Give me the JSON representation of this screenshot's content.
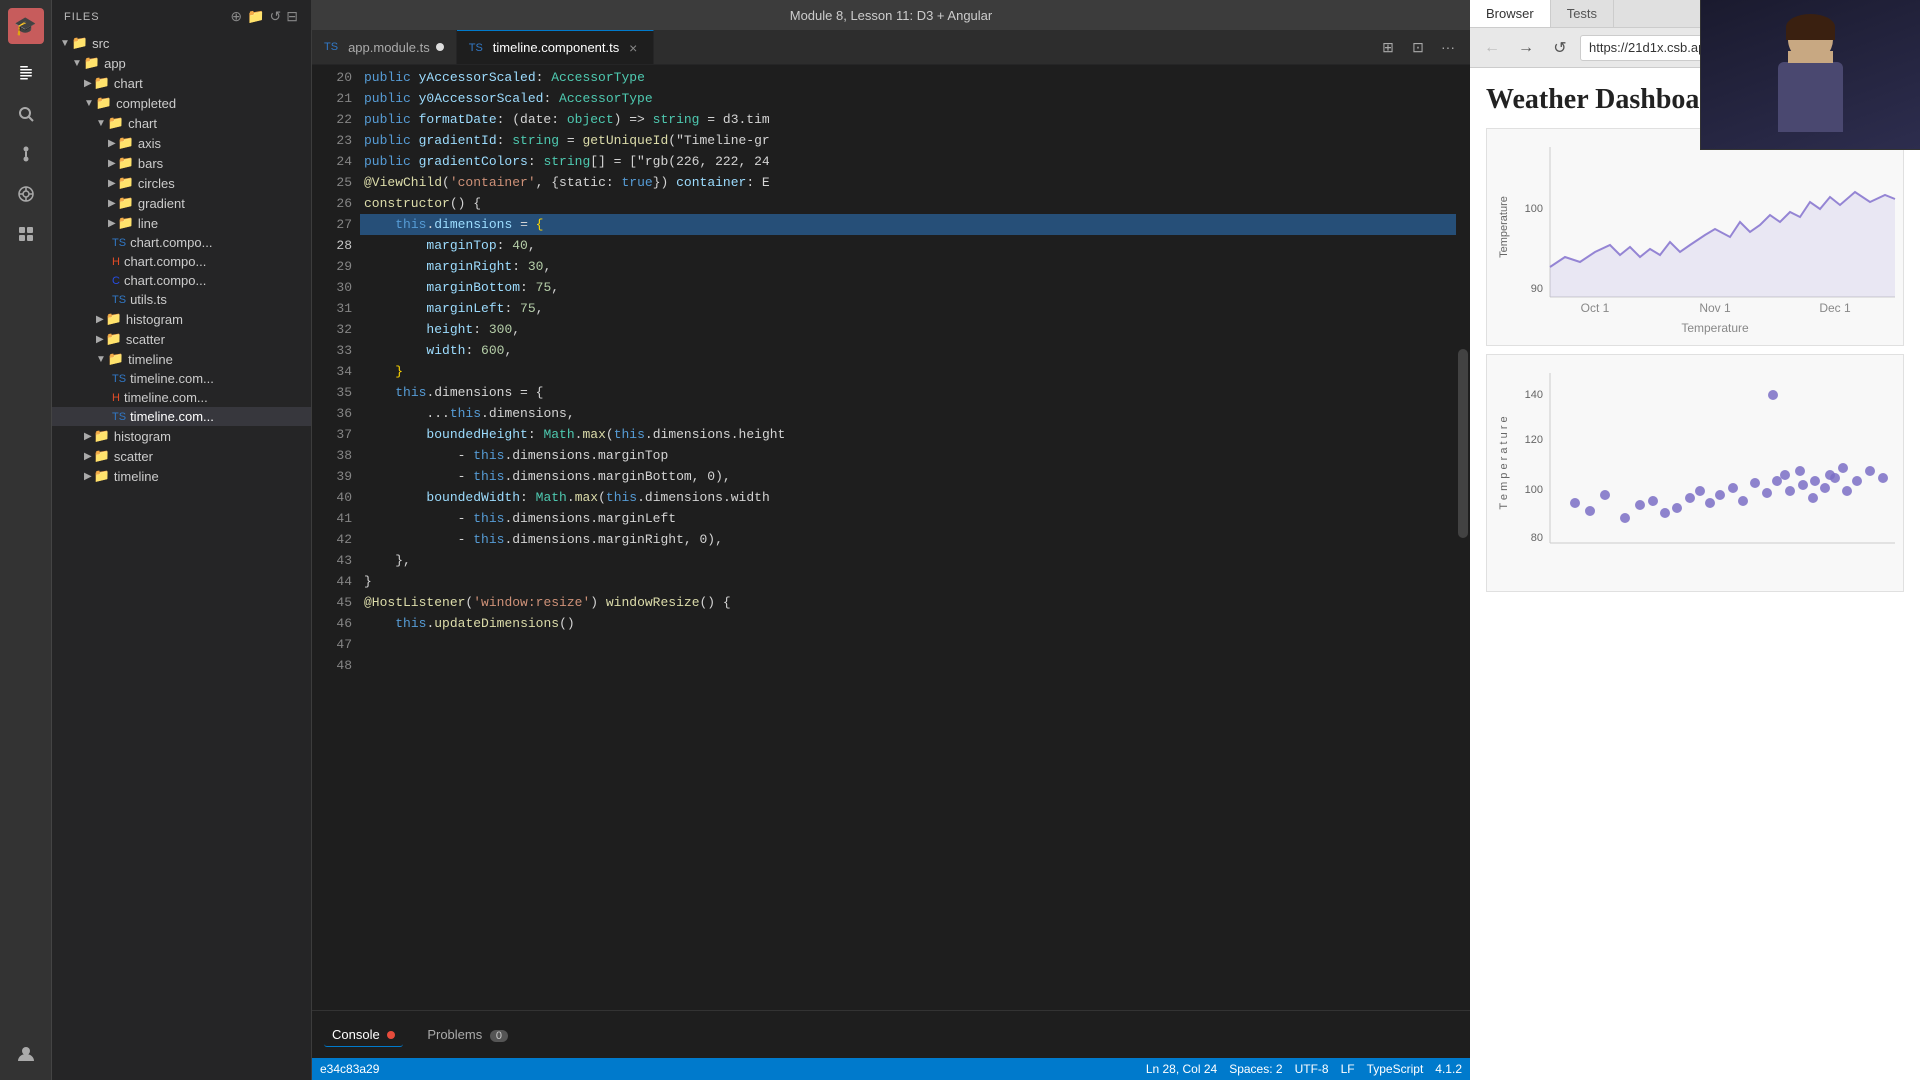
{
  "titleBar": {
    "title": "Module 8, Lesson 11: D3 + Angular"
  },
  "sidebar": {
    "logo": "🎓",
    "icons": [
      "files",
      "search",
      "git",
      "debug",
      "extensions",
      "user"
    ]
  },
  "fileExplorer": {
    "header": "Files",
    "tree": [
      {
        "id": "src",
        "type": "folder",
        "label": "src",
        "level": 0,
        "expanded": true
      },
      {
        "id": "app",
        "type": "folder",
        "label": "app",
        "level": 1,
        "expanded": true
      },
      {
        "id": "chart-folder",
        "type": "folder",
        "label": "chart",
        "level": 2,
        "expanded": false
      },
      {
        "id": "completed-folder",
        "type": "folder",
        "label": "completed",
        "level": 2,
        "expanded": true
      },
      {
        "id": "chart-sub",
        "type": "folder",
        "label": "chart",
        "level": 3,
        "expanded": true
      },
      {
        "id": "axis",
        "type": "folder",
        "label": "axis",
        "level": 4,
        "expanded": false
      },
      {
        "id": "bars",
        "type": "folder",
        "label": "bars",
        "level": 4,
        "expanded": false
      },
      {
        "id": "circles",
        "type": "folder",
        "label": "circles",
        "level": 4,
        "expanded": false
      },
      {
        "id": "gradient",
        "type": "folder",
        "label": "gradient",
        "level": 4,
        "expanded": false
      },
      {
        "id": "line",
        "type": "folder",
        "label": "line",
        "level": 4,
        "expanded": false
      },
      {
        "id": "chart-comp1",
        "type": "ts",
        "label": "chart.compo...",
        "level": 4
      },
      {
        "id": "chart-comp2",
        "type": "html",
        "label": "chart.compo...",
        "level": 4
      },
      {
        "id": "chart-comp3",
        "type": "css",
        "label": "chart.compo...",
        "level": 4
      },
      {
        "id": "utils",
        "type": "ts",
        "label": "utils.ts",
        "level": 4
      },
      {
        "id": "histogram-folder",
        "type": "folder",
        "label": "histogram",
        "level": 3,
        "expanded": false
      },
      {
        "id": "scatter-folder",
        "type": "folder",
        "label": "scatter",
        "level": 3,
        "expanded": false
      },
      {
        "id": "timeline-folder",
        "type": "folder",
        "label": "timeline",
        "level": 3,
        "expanded": true
      },
      {
        "id": "timeline-comp1",
        "type": "ts",
        "label": "timeline.com...",
        "level": 4
      },
      {
        "id": "timeline-comp2",
        "type": "html",
        "label": "timeline.com...",
        "level": 4
      },
      {
        "id": "timeline-comp3-active",
        "type": "ts",
        "label": "timeline.com...",
        "level": 4,
        "active": true
      },
      {
        "id": "histogram2",
        "type": "folder",
        "label": "histogram",
        "level": 2,
        "expanded": false
      },
      {
        "id": "scatter2",
        "type": "folder",
        "label": "scatter",
        "level": 2,
        "expanded": false
      },
      {
        "id": "timeline2",
        "type": "folder",
        "label": "timeline",
        "level": 2,
        "expanded": false
      }
    ]
  },
  "tabs": [
    {
      "id": "app-module",
      "label": "app.module.ts",
      "type": "ts",
      "modified": true,
      "active": false
    },
    {
      "id": "timeline-component",
      "label": "timeline.component.ts",
      "type": "ts",
      "modified": false,
      "active": true
    }
  ],
  "editor": {
    "lines": [
      {
        "num": 20,
        "tokens": [
          {
            "t": "kw",
            "v": "public "
          },
          {
            "t": "prop",
            "v": "yAccessorScaled"
          },
          {
            "t": "punc",
            "v": ": "
          },
          {
            "t": "type",
            "v": "AccessorType"
          }
        ]
      },
      {
        "num": 21,
        "tokens": [
          {
            "t": "kw",
            "v": "public "
          },
          {
            "t": "prop",
            "v": "y0AccessorScaled"
          },
          {
            "t": "punc",
            "v": ": "
          },
          {
            "t": "type",
            "v": "AccessorType"
          }
        ]
      },
      {
        "num": 22,
        "tokens": [
          {
            "t": "kw",
            "v": "public "
          },
          {
            "t": "prop",
            "v": "formatDate"
          },
          {
            "t": "punc",
            "v": ": (date: "
          },
          {
            "t": "type",
            "v": "object"
          },
          {
            "t": "punc",
            "v": ") => "
          },
          {
            "t": "type",
            "v": "string"
          },
          {
            "t": "punc",
            "v": " = d3.tim"
          }
        ]
      },
      {
        "num": 23,
        "tokens": [
          {
            "t": "kw",
            "v": "public "
          },
          {
            "t": "prop",
            "v": "gradientId"
          },
          {
            "t": "punc",
            "v": ": "
          },
          {
            "t": "type",
            "v": "string"
          },
          {
            "t": "punc",
            "v": " = "
          },
          {
            "t": "fn",
            "v": "getUniqueId"
          },
          {
            "t": "punc",
            "v": "(\"Timeline-gr"
          }
        ]
      },
      {
        "num": 24,
        "tokens": [
          {
            "t": "kw",
            "v": "public "
          },
          {
            "t": "prop",
            "v": "gradientColors"
          },
          {
            "t": "punc",
            "v": ": "
          },
          {
            "t": "type",
            "v": "string"
          },
          {
            "t": "punc",
            "v": "[] = [\"rgb(226, 222, 24"
          }
        ]
      },
      {
        "num": 25,
        "tokens": [
          {
            "t": "decorator",
            "v": "@ViewChild"
          },
          {
            "t": "punc",
            "v": "("
          },
          {
            "t": "str",
            "v": "'container'"
          },
          {
            "t": "punc",
            "v": ", {static: "
          },
          {
            "t": "kw",
            "v": "true"
          },
          {
            "t": "punc",
            "v": "}) "
          },
          {
            "t": "var",
            "v": "container"
          },
          {
            "t": "punc",
            "v": ": E"
          }
        ]
      },
      {
        "num": 26,
        "tokens": []
      },
      {
        "num": 27,
        "tokens": [
          {
            "t": "fn",
            "v": "constructor"
          },
          {
            "t": "punc",
            "v": "() {"
          }
        ]
      },
      {
        "num": 28,
        "highlight": true,
        "tokens": [
          {
            "t": "plain",
            "v": "    "
          },
          {
            "t": "kw",
            "v": "this"
          },
          {
            "t": "punc",
            "v": "."
          },
          {
            "t": "prop",
            "v": "dimensions"
          },
          {
            "t": "punc",
            "v": " = "
          },
          {
            "t": "bracket-match",
            "v": "{"
          }
        ]
      },
      {
        "num": 29,
        "tokens": [
          {
            "t": "plain",
            "v": "        "
          },
          {
            "t": "prop",
            "v": "marginTop"
          },
          {
            "t": "punc",
            "v": ": "
          },
          {
            "t": "num",
            "v": "40"
          },
          {
            "t": "punc",
            "v": ","
          }
        ]
      },
      {
        "num": 30,
        "tokens": [
          {
            "t": "plain",
            "v": "        "
          },
          {
            "t": "prop",
            "v": "marginRight"
          },
          {
            "t": "punc",
            "v": ": "
          },
          {
            "t": "num",
            "v": "30"
          },
          {
            "t": "punc",
            "v": ","
          }
        ]
      },
      {
        "num": 31,
        "tokens": [
          {
            "t": "plain",
            "v": "        "
          },
          {
            "t": "prop",
            "v": "marginBottom"
          },
          {
            "t": "punc",
            "v": ": "
          },
          {
            "t": "num",
            "v": "75"
          },
          {
            "t": "punc",
            "v": ","
          }
        ]
      },
      {
        "num": 32,
        "tokens": [
          {
            "t": "plain",
            "v": "        "
          },
          {
            "t": "prop",
            "v": "marginLeft"
          },
          {
            "t": "punc",
            "v": ": "
          },
          {
            "t": "num",
            "v": "75"
          },
          {
            "t": "punc",
            "v": ","
          }
        ]
      },
      {
        "num": 33,
        "tokens": [
          {
            "t": "plain",
            "v": "        "
          },
          {
            "t": "prop",
            "v": "height"
          },
          {
            "t": "punc",
            "v": ": "
          },
          {
            "t": "num",
            "v": "300"
          },
          {
            "t": "punc",
            "v": ","
          }
        ]
      },
      {
        "num": 34,
        "tokens": [
          {
            "t": "plain",
            "v": "        "
          },
          {
            "t": "prop",
            "v": "width"
          },
          {
            "t": "punc",
            "v": ": "
          },
          {
            "t": "num",
            "v": "600"
          },
          {
            "t": "punc",
            "v": ","
          }
        ]
      },
      {
        "num": 35,
        "tokens": [
          {
            "t": "plain",
            "v": "    "
          },
          {
            "t": "bracket-match",
            "v": "}"
          }
        ]
      },
      {
        "num": 36,
        "tokens": [
          {
            "t": "plain",
            "v": "    "
          },
          {
            "t": "kw",
            "v": "this"
          },
          {
            "t": "punc",
            "v": ".dimensions = {"
          }
        ]
      },
      {
        "num": 37,
        "tokens": [
          {
            "t": "plain",
            "v": "        ..."
          },
          {
            "t": "kw",
            "v": "this"
          },
          {
            "t": "punc",
            "v": ".dimensions,"
          }
        ]
      },
      {
        "num": 38,
        "tokens": [
          {
            "t": "plain",
            "v": "        "
          },
          {
            "t": "prop",
            "v": "boundedHeight"
          },
          {
            "t": "punc",
            "v": ": "
          },
          {
            "t": "type",
            "v": "Math"
          },
          {
            "t": "punc",
            "v": "."
          },
          {
            "t": "fn",
            "v": "max"
          },
          {
            "t": "punc",
            "v": "("
          },
          {
            "t": "kw",
            "v": "this"
          },
          {
            "t": "punc",
            "v": ".dimensions.height"
          }
        ]
      },
      {
        "num": 39,
        "tokens": [
          {
            "t": "plain",
            "v": "            - "
          },
          {
            "t": "kw",
            "v": "this"
          },
          {
            "t": "punc",
            "v": ".dimensions.marginTop"
          }
        ]
      },
      {
        "num": 40,
        "tokens": [
          {
            "t": "plain",
            "v": "            - "
          },
          {
            "t": "kw",
            "v": "this"
          },
          {
            "t": "punc",
            "v": ".dimensions.marginBottom, 0),"
          }
        ]
      },
      {
        "num": 41,
        "tokens": [
          {
            "t": "plain",
            "v": "        "
          },
          {
            "t": "prop",
            "v": "boundedWidth"
          },
          {
            "t": "punc",
            "v": ": "
          },
          {
            "t": "type",
            "v": "Math"
          },
          {
            "t": "punc",
            "v": "."
          },
          {
            "t": "fn",
            "v": "max"
          },
          {
            "t": "punc",
            "v": "("
          },
          {
            "t": "kw",
            "v": "this"
          },
          {
            "t": "punc",
            "v": ".dimensions.width"
          }
        ]
      },
      {
        "num": 42,
        "tokens": [
          {
            "t": "plain",
            "v": "            - "
          },
          {
            "t": "kw",
            "v": "this"
          },
          {
            "t": "punc",
            "v": ".dimensions.marginLeft"
          }
        ]
      },
      {
        "num": 43,
        "tokens": [
          {
            "t": "plain",
            "v": "            - "
          },
          {
            "t": "kw",
            "v": "this"
          },
          {
            "t": "punc",
            "v": ".dimensions.marginRight, 0),"
          }
        ]
      },
      {
        "num": 44,
        "tokens": [
          {
            "t": "plain",
            "v": "    },"
          }
        ]
      },
      {
        "num": 45,
        "tokens": [
          {
            "t": "plain",
            "v": "}"
          }
        ]
      },
      {
        "num": 46,
        "tokens": []
      },
      {
        "num": 47,
        "tokens": [
          {
            "t": "decorator",
            "v": "@HostListener"
          },
          {
            "t": "punc",
            "v": "("
          },
          {
            "t": "str",
            "v": "'window:resize'"
          },
          {
            "t": "punc",
            "v": ") "
          },
          {
            "t": "fn",
            "v": "windowResize"
          },
          {
            "t": "punc",
            "v": "() {"
          }
        ]
      },
      {
        "num": 48,
        "tokens": [
          {
            "t": "plain",
            "v": "    "
          },
          {
            "t": "kw",
            "v": "this"
          },
          {
            "t": "punc",
            "v": "."
          },
          {
            "t": "fn",
            "v": "updateDimensions"
          },
          {
            "t": "punc",
            "v": "()"
          }
        ]
      }
    ]
  },
  "browser": {
    "url": "https://21d1x.csb.app/",
    "tabs": [
      "Browser",
      "Tests"
    ],
    "activeTab": "Browser",
    "title": "Weather Dashboard",
    "charts": {
      "line": {
        "yLabel": "Temperature",
        "xLabel": "Temperature",
        "xTicks": [
          "Oct 1",
          "Nov 1",
          "Dec 1"
        ],
        "yTicks": [
          "100",
          "90"
        ]
      },
      "scatter": {
        "yTicks": [
          "80",
          "100",
          "120",
          "140"
        ]
      }
    }
  },
  "statusBar": {
    "gitBranch": "e34c83a29",
    "cursorPos": "Ln 28, Col 24",
    "spaces": "Spaces: 2",
    "encoding": "UTF-8",
    "lineEnding": "LF",
    "language": "TypeScript",
    "version": "4.1.2"
  },
  "bottomPanel": {
    "tabs": [
      "Console",
      "Problems"
    ],
    "consoleIndicator": true,
    "problemsCount": "0"
  }
}
